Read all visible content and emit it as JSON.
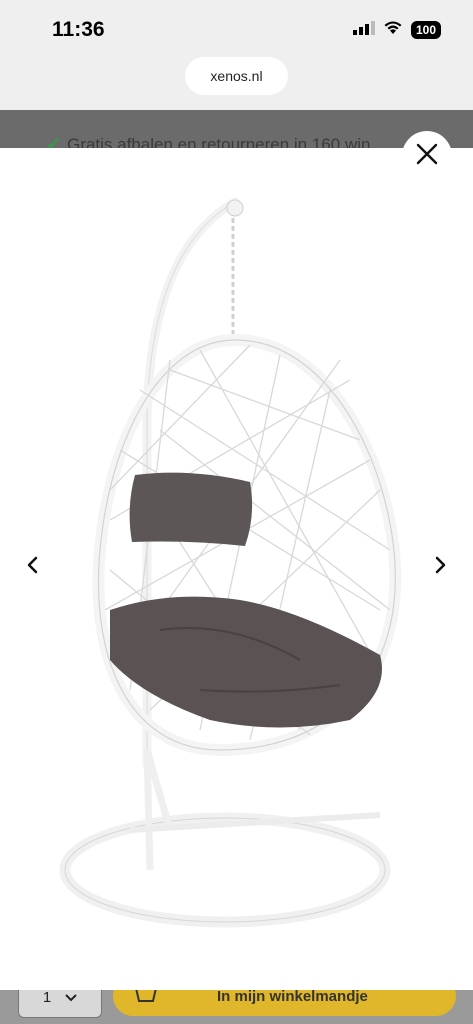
{
  "status_bar": {
    "time": "11:36",
    "battery": "100"
  },
  "browser": {
    "url": "xenos.nl"
  },
  "banner": {
    "text": "Gratis afhalen en retourneren in 160 win"
  },
  "gallery": {
    "image_alt": "White egg-shaped hanging chair with grey cushions",
    "prev_icon": "chevron-left-icon",
    "next_icon": "chevron-right-icon",
    "close_icon": "close-icon"
  },
  "cart": {
    "quantity": "1",
    "button_label": "In mijn winkelmandje"
  },
  "colors": {
    "accent": "#e0b72a",
    "check": "#2e9e48",
    "cushion": "#5d5656"
  }
}
